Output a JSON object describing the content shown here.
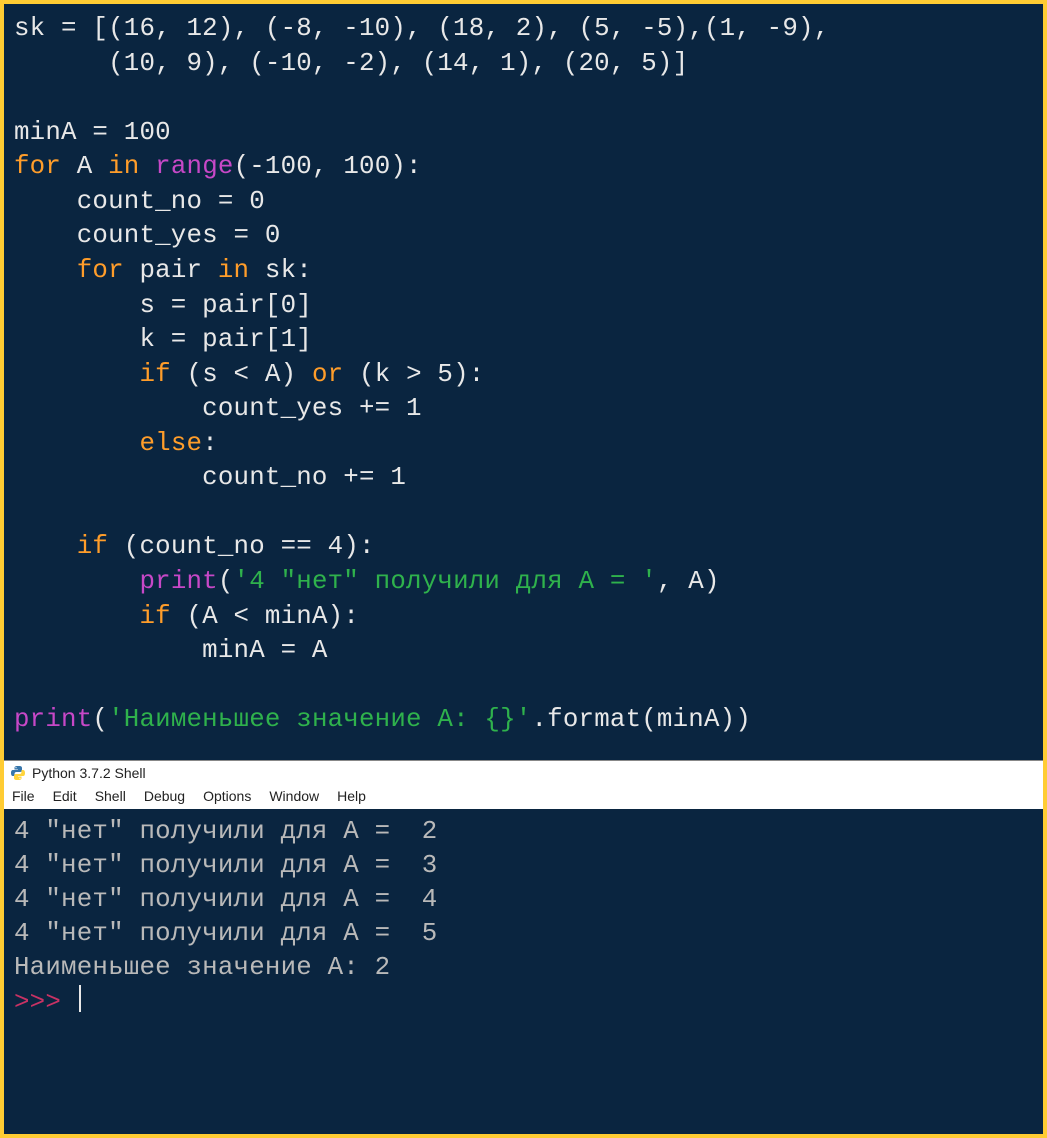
{
  "editor": {
    "code_tokens": [
      [
        {
          "t": "sk = [(16, 12), (-8, -10), (18, 2), (5, -5),(1, -9),"
        }
      ],
      [
        {
          "t": "      (10, 9), (-10, -2), (14, 1), (20, 5)]"
        }
      ],
      [
        {
          "t": ""
        }
      ],
      [
        {
          "t": "minA = 100"
        }
      ],
      [
        {
          "t": "for",
          "c": "kw"
        },
        {
          "t": " A "
        },
        {
          "t": "in",
          "c": "kw"
        },
        {
          "t": " "
        },
        {
          "t": "range",
          "c": "fn"
        },
        {
          "t": "(-100, 100):"
        }
      ],
      [
        {
          "t": "    count_no = 0"
        }
      ],
      [
        {
          "t": "    count_yes = 0"
        }
      ],
      [
        {
          "t": "    "
        },
        {
          "t": "for",
          "c": "kw"
        },
        {
          "t": " pair "
        },
        {
          "t": "in",
          "c": "kw"
        },
        {
          "t": " sk:"
        }
      ],
      [
        {
          "t": "        s = pair[0]"
        }
      ],
      [
        {
          "t": "        k = pair[1]"
        }
      ],
      [
        {
          "t": "        "
        },
        {
          "t": "if",
          "c": "kw"
        },
        {
          "t": " (s < A) "
        },
        {
          "t": "or",
          "c": "kw"
        },
        {
          "t": " (k > 5):"
        }
      ],
      [
        {
          "t": "            count_yes += 1"
        }
      ],
      [
        {
          "t": "        "
        },
        {
          "t": "else",
          "c": "kw"
        },
        {
          "t": ":"
        }
      ],
      [
        {
          "t": "            count_no += 1"
        }
      ],
      [
        {
          "t": ""
        }
      ],
      [
        {
          "t": "    "
        },
        {
          "t": "if",
          "c": "kw"
        },
        {
          "t": " (count_no == 4):"
        }
      ],
      [
        {
          "t": "        "
        },
        {
          "t": "print",
          "c": "fn"
        },
        {
          "t": "("
        },
        {
          "t": "'4 \"нет\" получили для A = '",
          "c": "str"
        },
        {
          "t": ", A)"
        }
      ],
      [
        {
          "t": "        "
        },
        {
          "t": "if",
          "c": "kw"
        },
        {
          "t": " (A < minA):"
        }
      ],
      [
        {
          "t": "            minA = A"
        }
      ],
      [
        {
          "t": ""
        }
      ],
      [
        {
          "t": "print",
          "c": "fn"
        },
        {
          "t": "("
        },
        {
          "t": "'Наименьшее значение A: {}'",
          "c": "str"
        },
        {
          "t": ".format(minA))"
        }
      ]
    ]
  },
  "shell": {
    "title": "Python 3.7.2 Shell",
    "menu": [
      "File",
      "Edit",
      "Shell",
      "Debug",
      "Options",
      "Window",
      "Help"
    ],
    "output": [
      "4 \"нет\" получили для A =  2",
      "4 \"нет\" получили для A =  3",
      "4 \"нет\" получили для A =  4",
      "4 \"нет\" получили для A =  5",
      "Наименьшее значение A: 2"
    ],
    "prompt": ">>> "
  }
}
